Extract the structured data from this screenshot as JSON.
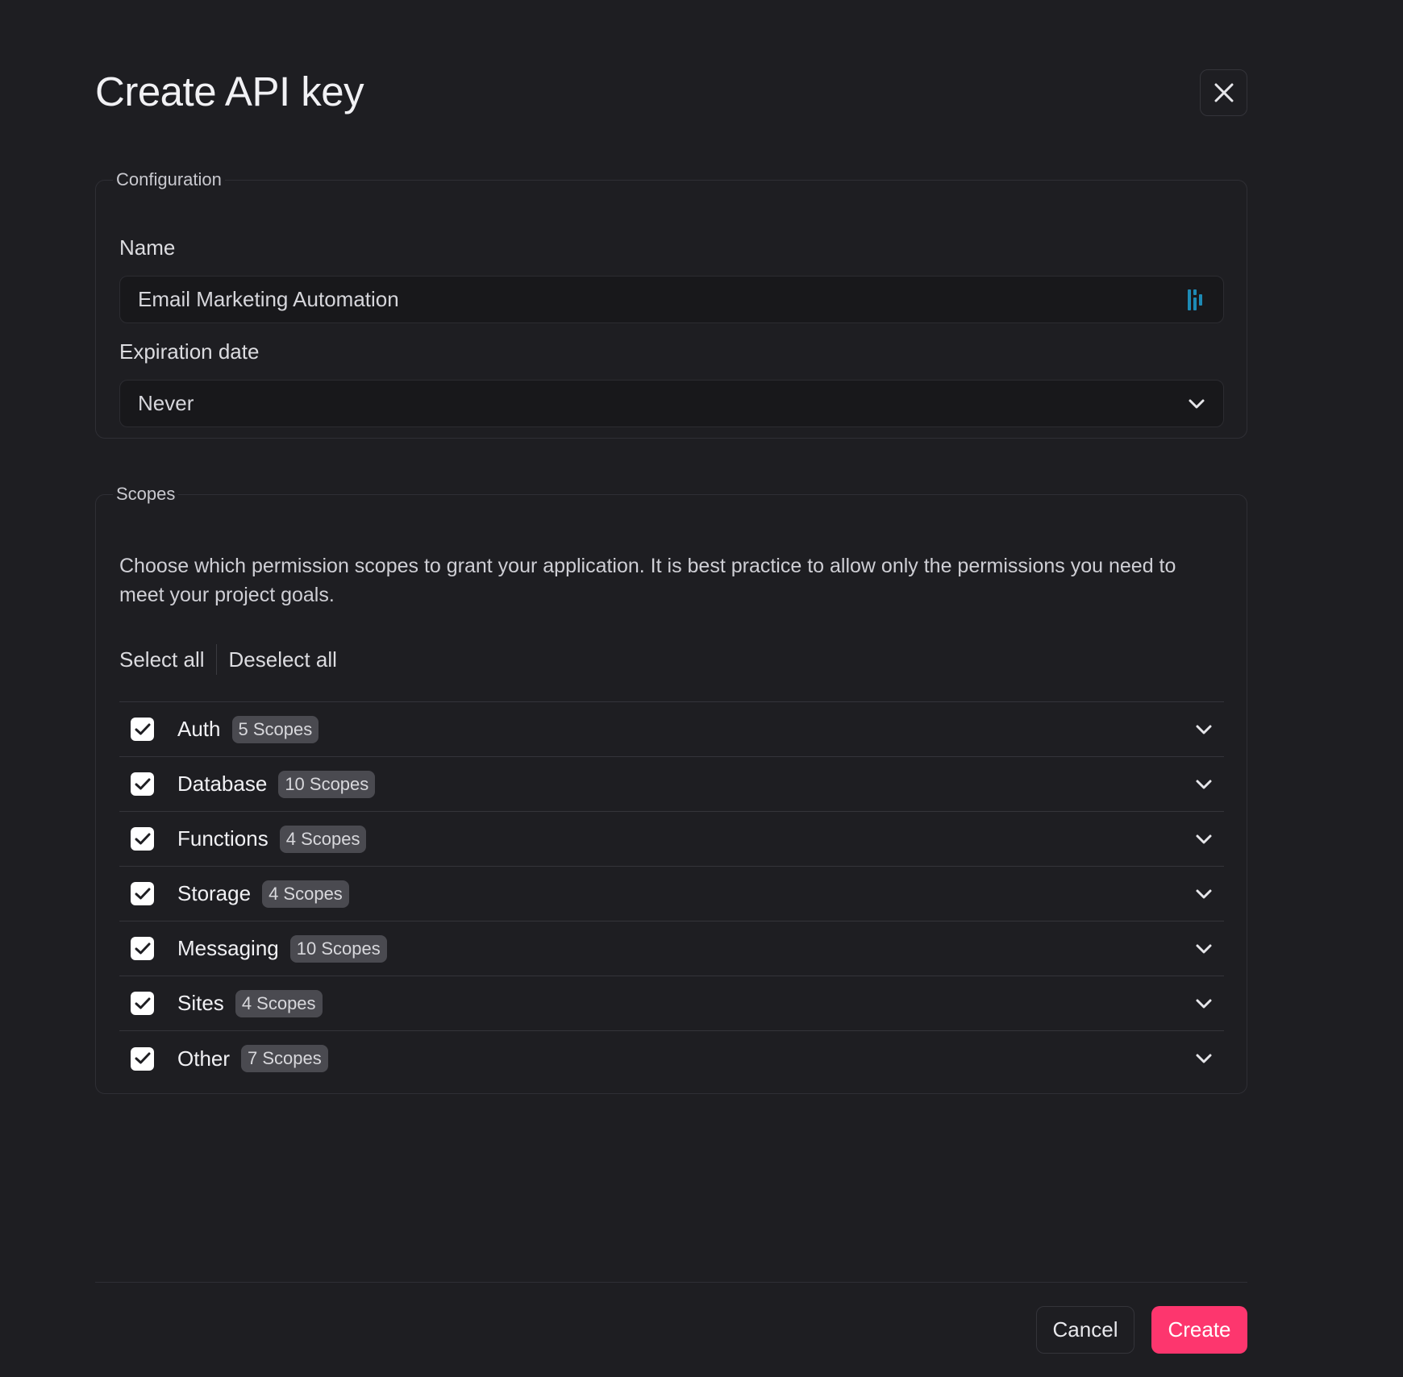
{
  "dialog": {
    "title": "Create API key",
    "close_icon": "close-icon"
  },
  "configuration": {
    "legend": "Configuration",
    "name_label": "Name",
    "name_value": "Email Marketing Automation",
    "expiration_label": "Expiration date",
    "expiration_value": "Never"
  },
  "scopes": {
    "legend": "Scopes",
    "description": "Choose which permission scopes to grant your application. It is best practice to allow only the permissions you need to meet your project goals.",
    "select_all": "Select all",
    "deselect_all": "Deselect all",
    "items": [
      {
        "label": "Auth",
        "badge": "5 Scopes",
        "checked": true
      },
      {
        "label": "Database",
        "badge": "10 Scopes",
        "checked": true
      },
      {
        "label": "Functions",
        "badge": "4 Scopes",
        "checked": true
      },
      {
        "label": "Storage",
        "badge": "4 Scopes",
        "checked": true
      },
      {
        "label": "Messaging",
        "badge": "10 Scopes",
        "checked": true
      },
      {
        "label": "Sites",
        "badge": "4 Scopes",
        "checked": true
      },
      {
        "label": "Other",
        "badge": "7 Scopes",
        "checked": true
      }
    ]
  },
  "footer": {
    "cancel_label": "Cancel",
    "create_label": "Create"
  },
  "colors": {
    "background": "#1e1e22",
    "accent": "#fd366e",
    "input_icon": "#1d8ab5"
  }
}
